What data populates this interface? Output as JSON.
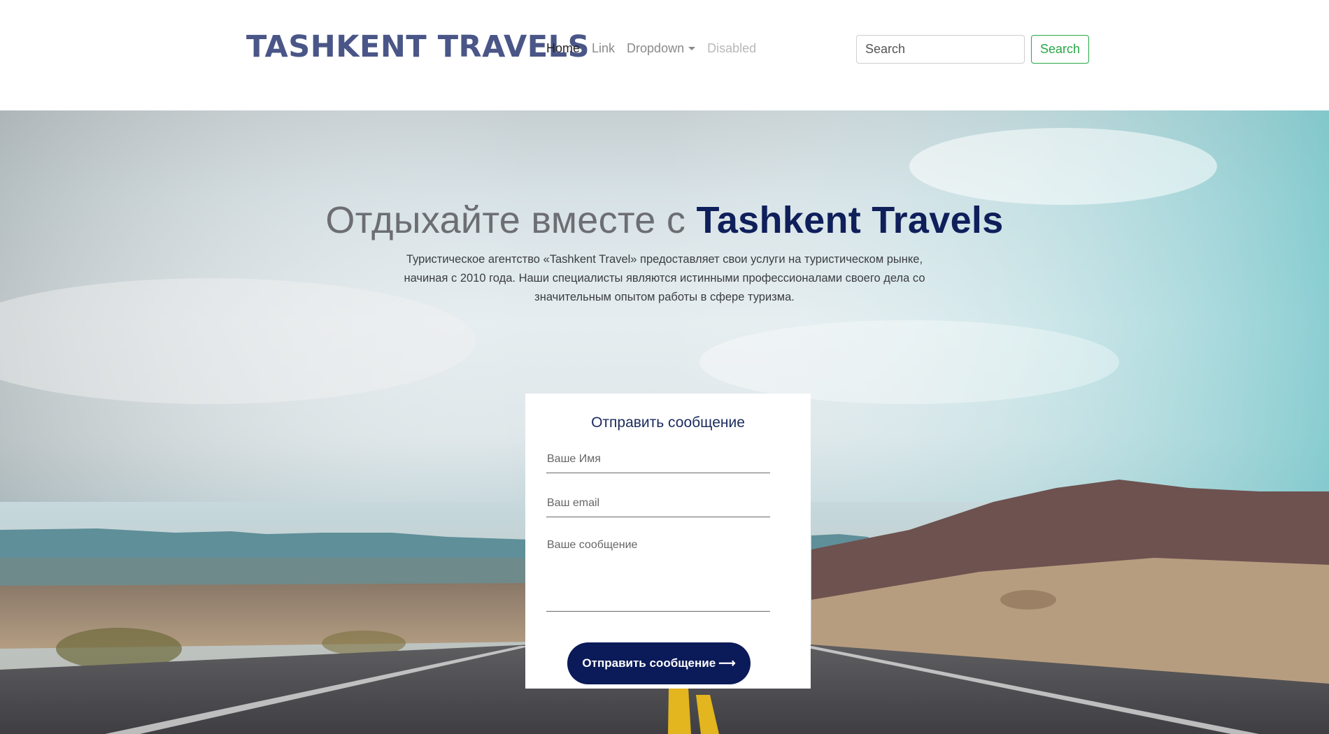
{
  "navbar": {
    "brand": "TASHKENT TRAVELS",
    "links": {
      "home": "Home",
      "link": "Link",
      "dropdown": "Dropdown",
      "disabled": "Disabled"
    },
    "search": {
      "placeholder": "Search",
      "button_label": "Search"
    }
  },
  "hero": {
    "title_light": "Отдыхайте вместе с ",
    "title_strong": "Tashkent Travels",
    "description": "Туристическое агентство «Tashkent Travel» предоставляет свои услуги на туристическом рынке, начиная с 2010 года. Наши специалисты являются истинными профессионалами своего дела со значительным опытом работы в сфере туризма."
  },
  "contact_form": {
    "title": "Отправить сообщение",
    "name_placeholder": "Ваше Имя",
    "email_placeholder": "Ваш email",
    "message_placeholder": "Ваше сообщение",
    "submit_label": "Отправить сообщение"
  },
  "colors": {
    "brand": "#4a5687",
    "accent_dark_blue": "#0b1a58",
    "search_green": "#28a745"
  },
  "icons": {
    "submit_arrow": "right-arrow-icon",
    "dropdown_caret": "caret-down-icon"
  }
}
